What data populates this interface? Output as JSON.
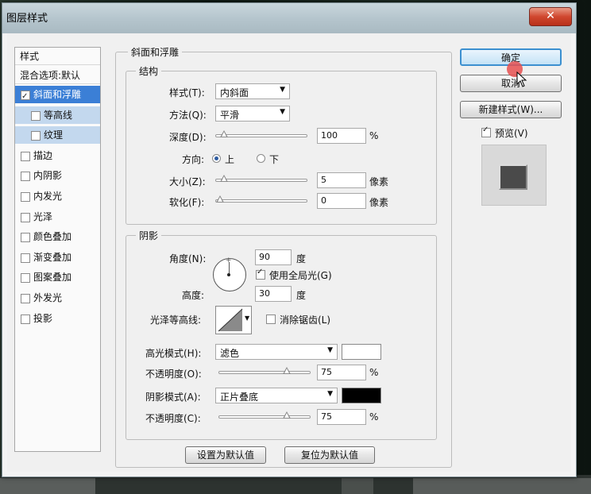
{
  "dialog": {
    "title": "图层样式",
    "close_glyph": "✕"
  },
  "styles_list": {
    "header": "样式",
    "blend_options": "混合选项:默认",
    "items": [
      {
        "label": "斜面和浮雕",
        "checked": true
      },
      {
        "label": "等高线",
        "checked": false
      },
      {
        "label": "纹理",
        "checked": false
      },
      {
        "label": "描边",
        "checked": false
      },
      {
        "label": "内阴影",
        "checked": false
      },
      {
        "label": "内发光",
        "checked": false
      },
      {
        "label": "光泽",
        "checked": false
      },
      {
        "label": "颜色叠加",
        "checked": false
      },
      {
        "label": "渐变叠加",
        "checked": false
      },
      {
        "label": "图案叠加",
        "checked": false
      },
      {
        "label": "外发光",
        "checked": false
      },
      {
        "label": "投影",
        "checked": false
      }
    ]
  },
  "bevel": {
    "group_label": "斜面和浮雕",
    "structure": {
      "label": "结构",
      "style_label": "样式(T):",
      "style_value": "内斜面",
      "technique_label": "方法(Q):",
      "technique_value": "平滑",
      "depth_label": "深度(D):",
      "depth_value": "100",
      "depth_unit": "%",
      "depth_level": 0.05,
      "direction_label": "方向:",
      "direction_up": "上",
      "direction_down": "下",
      "direction_selected": "上",
      "size_label": "大小(Z):",
      "size_value": "5",
      "size_unit": "像素",
      "size_level": 0.05,
      "soften_label": "软化(F):",
      "soften_value": "0",
      "soften_unit": "像素",
      "soften_level": 0.0
    },
    "shading": {
      "label": "阴影",
      "angle_label": "角度(N):",
      "angle_value": "90",
      "angle_unit": "度",
      "global_light_label": "使用全局光(G)",
      "global_light_checked": true,
      "altitude_label": "高度:",
      "altitude_value": "30",
      "altitude_unit": "度",
      "gloss_contour_label": "光泽等高线:",
      "anti_aliased_label": "消除锯齿(L)",
      "anti_aliased_checked": false,
      "highlight_mode_label": "高光模式(H):",
      "highlight_mode_value": "滤色",
      "highlight_color": "#ffffff",
      "highlight_opacity_label": "不透明度(O):",
      "highlight_opacity_value": "75",
      "highlight_opacity_unit": "%",
      "highlight_opacity_level": 0.75,
      "shadow_mode_label": "阴影模式(A):",
      "shadow_mode_value": "正片叠底",
      "shadow_color": "#000000",
      "shadow_opacity_label": "不透明度(C):",
      "shadow_opacity_value": "75",
      "shadow_opacity_unit": "%",
      "shadow_opacity_level": 0.75
    },
    "make_default_label": "设置为默认值",
    "reset_default_label": "复位为默认值"
  },
  "actions": {
    "ok_label": "确定",
    "cancel_label": "取消",
    "new_style_label": "新建样式(W)...",
    "preview_label": "预览(V)",
    "preview_checked": true
  }
}
